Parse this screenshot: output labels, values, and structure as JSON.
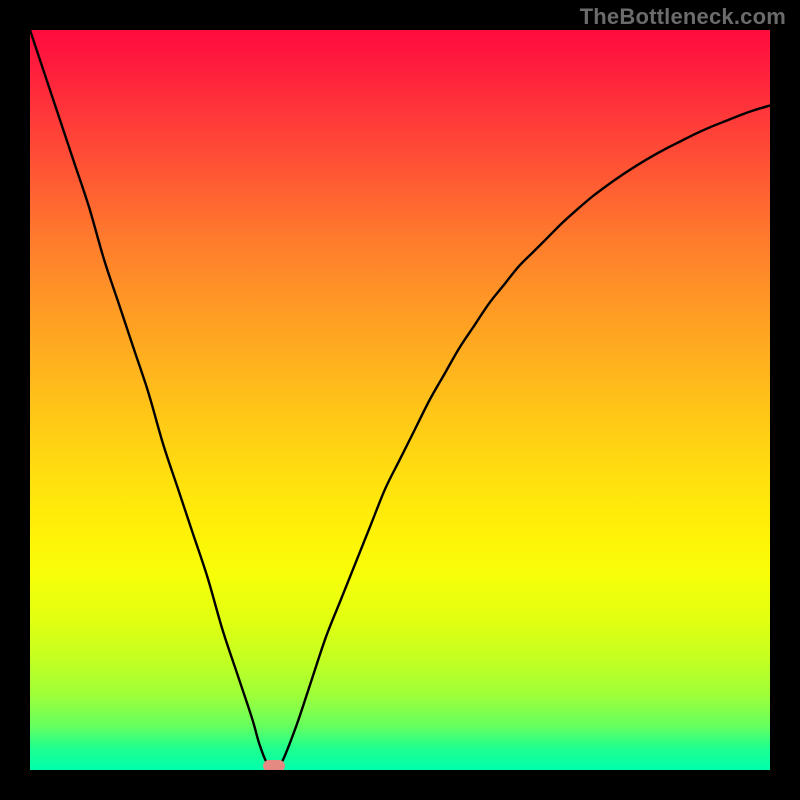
{
  "watermark": "TheBottleneck.com",
  "colors": {
    "background": "#000000",
    "curve_stroke": "#000000",
    "marker": "#e58a82",
    "gradient_top": "#ff0b3e",
    "gradient_bottom": "#00ffae"
  },
  "chart_data": {
    "type": "line",
    "title": "",
    "xlabel": "",
    "ylabel": "",
    "xlim": [
      0,
      100
    ],
    "ylim": [
      0,
      100
    ],
    "grid": false,
    "legend": false,
    "x": [
      0,
      2,
      4,
      6,
      8,
      10,
      12,
      14,
      16,
      18,
      20,
      22,
      24,
      26,
      28,
      30,
      31,
      32,
      33,
      34,
      36,
      38,
      40,
      42,
      44,
      46,
      48,
      50,
      52,
      54,
      56,
      58,
      60,
      62,
      64,
      66,
      68,
      70,
      72,
      74,
      76,
      78,
      80,
      82,
      84,
      86,
      88,
      90,
      92,
      94,
      96,
      98,
      100
    ],
    "y": [
      100,
      94,
      88,
      82,
      76,
      69,
      63,
      57,
      51,
      44,
      38,
      32,
      26,
      19,
      13,
      7,
      3.5,
      1,
      0.5,
      1,
      6,
      12,
      18,
      23,
      28,
      33,
      38,
      42,
      46,
      50,
      53.5,
      57,
      60,
      63,
      65.5,
      68,
      70,
      72,
      74,
      75.8,
      77.5,
      79,
      80.4,
      81.7,
      82.9,
      84,
      85,
      86,
      86.9,
      87.7,
      88.5,
      89.2,
      89.8
    ],
    "minimum": {
      "x": 33,
      "y": 0.5
    },
    "annotations": []
  }
}
